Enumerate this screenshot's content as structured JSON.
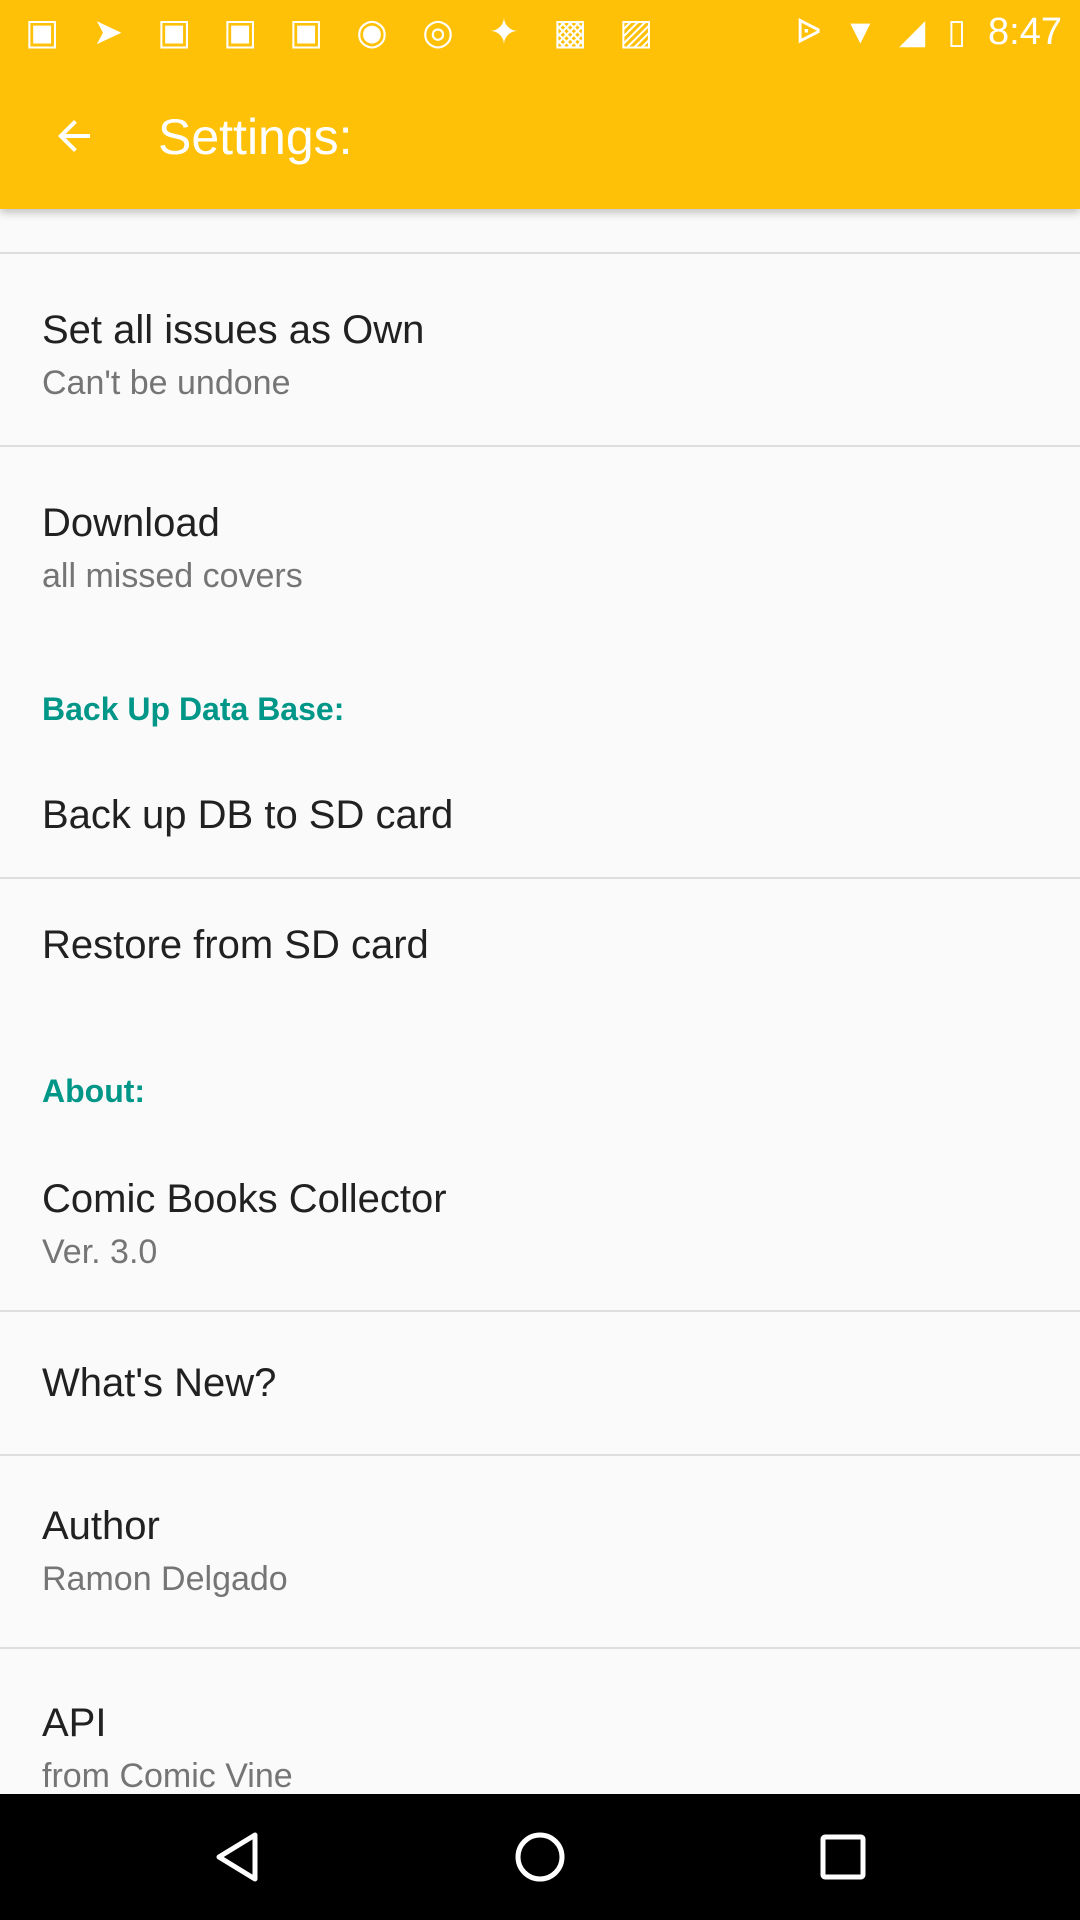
{
  "status_bar": {
    "time": "8:47",
    "left_icons": [
      "app-icon",
      "send-icon",
      "app-icon",
      "app-icon",
      "app-icon",
      "record-icon",
      "target-icon",
      "satellite-icon",
      "lock-icon",
      "android-icon"
    ],
    "right_icons": [
      "bluetooth-icon",
      "wifi-icon",
      "cell-signal-icon",
      "battery-icon"
    ]
  },
  "app_bar": {
    "title": "Settings:",
    "background": "#FFC107"
  },
  "settings": {
    "set_all_own": {
      "title": "Set all issues as Own",
      "summary": "Can't be undone"
    },
    "download": {
      "title": "Download",
      "summary": "all missed covers"
    },
    "backup_category": "Back Up Data Base:",
    "backup_db": {
      "title": "Back up DB to SD card"
    },
    "restore_db": {
      "title": "Restore from SD card"
    },
    "about_category": "About:",
    "app_info": {
      "title": "Comic Books Collector",
      "summary": "Ver. 3.0"
    },
    "whats_new": {
      "title": "What's New?"
    },
    "author": {
      "title": "Author",
      "summary": "Ramon Delgado"
    },
    "api": {
      "title": "API",
      "summary": "from Comic Vine"
    }
  },
  "colors": {
    "accent": "#009688",
    "primary_text": "#212121",
    "secondary_text": "#757575"
  }
}
